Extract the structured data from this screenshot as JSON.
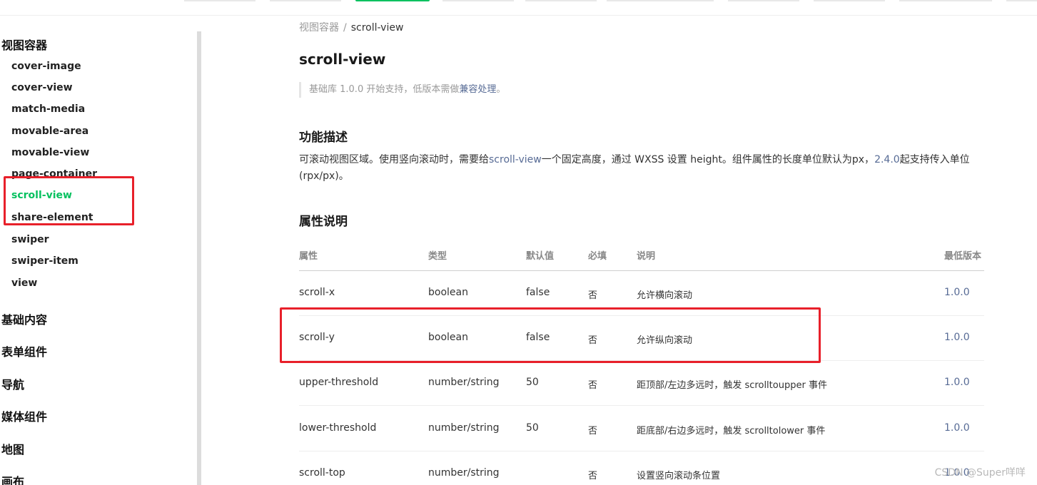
{
  "sidebar": {
    "group_view_container": "视图容器",
    "items": [
      "cover-image",
      "cover-view",
      "match-media",
      "movable-area",
      "movable-view",
      "page-container",
      "scroll-view",
      "share-element",
      "swiper",
      "swiper-item",
      "view"
    ],
    "active_item": "scroll-view",
    "groups_below": [
      "基础内容",
      "表单组件",
      "导航",
      "媒体组件",
      "地图",
      "画布"
    ]
  },
  "breadcrumb": {
    "parent": "视图容器",
    "separator": "/",
    "current": "scroll-view"
  },
  "page_title": "scroll-view",
  "note": {
    "prefix": "基础库 1.0.0 开始支持，低版本需做",
    "link": "兼容处理",
    "suffix": "。"
  },
  "section_desc": {
    "heading": "功能描述",
    "text_1": "可滚动视图区域。使用竖向滚动时，需要给",
    "link_1": "scroll-view",
    "text_2": "一个固定高度，通过 WXSS 设置 height。组件属性的长度单位默认为px，",
    "link_2": "2.4.0",
    "text_3": "起支持传入单位",
    "text_4": "(rpx/px)。"
  },
  "section_props": {
    "heading": "属性说明",
    "columns": [
      "属性",
      "类型",
      "默认值",
      "必填",
      "说明",
      "最低版本"
    ],
    "rows": [
      [
        "scroll-x",
        "boolean",
        "false",
        "否",
        "允许横向滚动",
        "1.0.0"
      ],
      [
        "scroll-y",
        "boolean",
        "false",
        "否",
        "允许纵向滚动",
        "1.0.0"
      ],
      [
        "upper-threshold",
        "number/string",
        "50",
        "否",
        "距顶部/左边多远时，触发 scrolltoupper 事件",
        "1.0.0"
      ],
      [
        "lower-threshold",
        "number/string",
        "50",
        "否",
        "距底部/右边多远时，触发 scrolltolower 事件",
        "1.0.0"
      ],
      [
        "scroll-top",
        "number/string",
        "",
        "否",
        "设置竖向滚动条位置",
        "1.0.0"
      ]
    ]
  },
  "watermark": "CSDN @Super咩咩",
  "colors": {
    "accent_green": "#07c160",
    "link": "#576b95",
    "annotation_red": "#e8202a"
  }
}
